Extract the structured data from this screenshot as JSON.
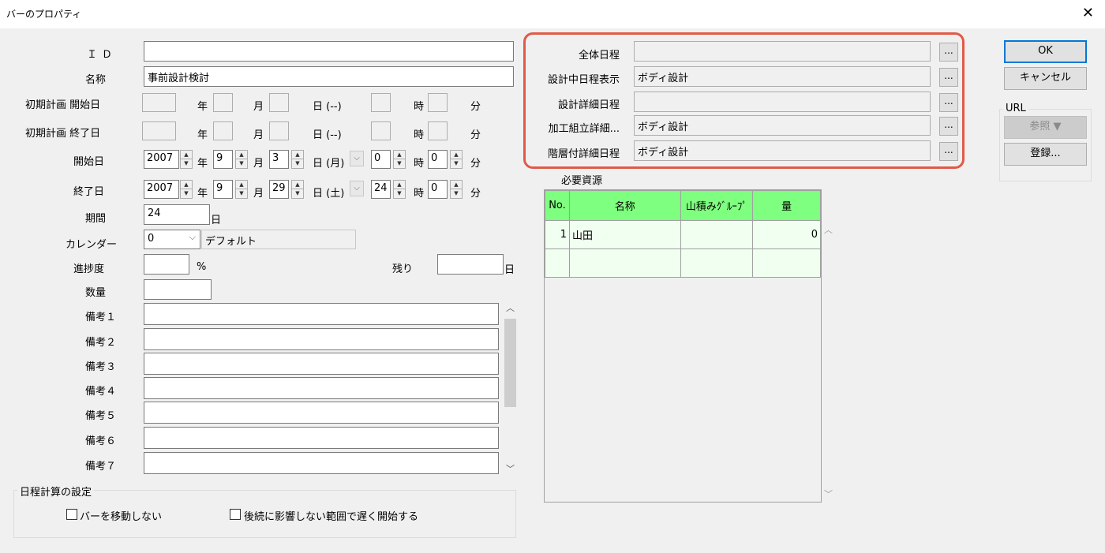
{
  "window": {
    "title": "バーのプロパティ",
    "close_glyph": "✕"
  },
  "fields": {
    "id": {
      "label": "ＩＤ",
      "value": ""
    },
    "name": {
      "label": "名称",
      "value": "事前設計検討"
    },
    "plan_start": {
      "label": "初期計画 開始日",
      "year": "年",
      "month": "月",
      "day": "日 (--)",
      "hour": "時",
      "minute": "分"
    },
    "plan_end": {
      "label": "初期計画 終了日",
      "year": "年",
      "month": "月",
      "day": "日 (--)",
      "hour": "時",
      "minute": "分"
    },
    "start": {
      "label": "開始日",
      "year_value": "2007",
      "year": "年",
      "month_value": "9",
      "month": "月",
      "day_value": "3",
      "day": "日 (月)",
      "hour_value": "0",
      "hour": "時",
      "minute_value": "0",
      "minute": "分"
    },
    "end": {
      "label": "終了日",
      "year_value": "2007",
      "year": "年",
      "month_value": "9",
      "month": "月",
      "day_value": "29",
      "day": "日 (土)",
      "hour_value": "24",
      "hour": "時",
      "minute_value": "0",
      "minute": "分"
    },
    "duration": {
      "label": "期間",
      "value": "24",
      "unit": "日"
    },
    "calendar": {
      "label": "カレンダー",
      "value": "0",
      "name": "デフォルト"
    },
    "progress": {
      "label": "進捗度",
      "value": "",
      "unit": "%"
    },
    "remaining": {
      "label": "残り",
      "value": "",
      "unit": "日"
    },
    "quantity": {
      "label": "数量",
      "value": ""
    },
    "notes": [
      {
        "label": "備考１",
        "value": ""
      },
      {
        "label": "備考２",
        "value": ""
      },
      {
        "label": "備考３",
        "value": ""
      },
      {
        "label": "備考４",
        "value": ""
      },
      {
        "label": "備考５",
        "value": ""
      },
      {
        "label": "備考６",
        "value": ""
      },
      {
        "label": "備考７",
        "value": ""
      }
    ]
  },
  "schedule": {
    "title": "日程計算の設定",
    "no_move": "バーを移動しない",
    "late_start": "後続に影響しない範囲で遅く開始する"
  },
  "schedules": [
    {
      "label": "全体日程",
      "value": ""
    },
    {
      "label": "設計中日程表示",
      "value": "ボディ設計"
    },
    {
      "label": "設計詳細日程",
      "value": ""
    },
    {
      "label": "加工組立詳細...",
      "value": "ボディ設計"
    },
    {
      "label": "階層付詳細日程",
      "value": "ボディ設計"
    }
  ],
  "ellipsis_label": "...",
  "resources": {
    "title": "必要資源",
    "headers": [
      "No.",
      "名称",
      "山積みｸﾞﾙｰﾌﾟ",
      "量"
    ],
    "rows": [
      {
        "no": "1",
        "name": "山田",
        "group": "",
        "qty": "0"
      },
      {
        "no": "",
        "name": "",
        "group": "",
        "qty": ""
      }
    ]
  },
  "buttons": {
    "ok": "OK",
    "cancel": "キャンセル",
    "url_group": "URL",
    "browse": "参照 ▼",
    "register": "登録..."
  }
}
